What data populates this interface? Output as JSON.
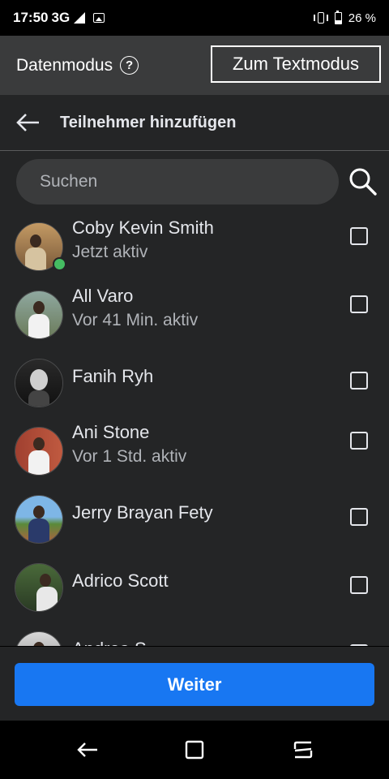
{
  "status_bar": {
    "time": "17:50",
    "network": "3G",
    "network_sup": "3G",
    "battery": "26 %",
    "icons": [
      "signal-icon",
      "gallery-icon",
      "vibrate-icon",
      "battery-icon"
    ]
  },
  "mode_bar": {
    "label": "Datenmodus",
    "help_glyph": "?",
    "text_mode_button": "Zum Textmodus"
  },
  "header": {
    "title": "Teilnehmer hinzufügen",
    "back_icon": "arrow-left-icon"
  },
  "search": {
    "placeholder": "Suchen",
    "value": "",
    "icon": "search-icon"
  },
  "participants": [
    {
      "name": "Coby Kevin Smith",
      "status": "Jetzt aktiv",
      "online": true,
      "checked": false
    },
    {
      "name": "All Varo",
      "status": "Vor 41 Min. aktiv",
      "online": false,
      "checked": false
    },
    {
      "name": "Fanih Ryh",
      "status": "",
      "online": false,
      "checked": false
    },
    {
      "name": "Ani Stone",
      "status": "Vor 1 Std. aktiv",
      "online": false,
      "checked": false
    },
    {
      "name": "Jerry Brayan Fety",
      "status": "",
      "online": false,
      "checked": false
    },
    {
      "name": "Adrico Scott",
      "status": "",
      "online": false,
      "checked": false
    },
    {
      "name": "Andrea S",
      "status": "",
      "online": false,
      "checked": false
    }
  ],
  "footer": {
    "next_button": "Weiter"
  },
  "colors": {
    "background": "#242526",
    "mode_bar": "#3a3b3c",
    "accent": "#1877f2",
    "online": "#45bd62",
    "text_primary": "#e4e6eb",
    "text_secondary": "#b0b3b8"
  },
  "nav_bar": {
    "icons": [
      "nav-back-icon",
      "nav-recents-icon",
      "nav-home-icon"
    ]
  }
}
